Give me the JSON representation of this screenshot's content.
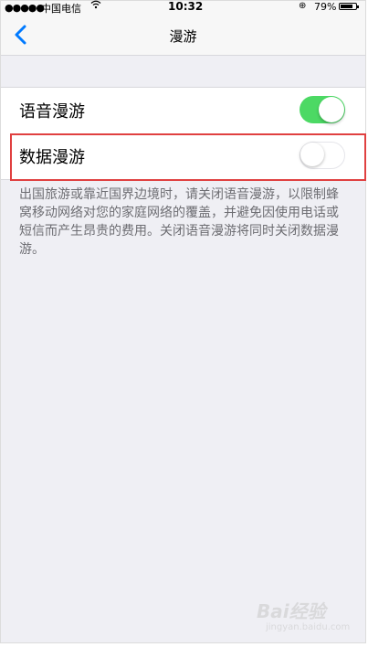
{
  "status_bar": {
    "signal": "●●●●●",
    "carrier": "中国电信",
    "time": "10:32",
    "battery_percent": "79%",
    "battery_level": 0.79
  },
  "navbar": {
    "title": "漫游",
    "back_icon": "chevron-left-icon"
  },
  "settings": {
    "items": [
      {
        "label": "语音漫游",
        "enabled": true
      },
      {
        "label": "数据漫游",
        "enabled": false
      }
    ]
  },
  "footer_text": "出国旅游或靠近国界边境时，请关闭语音漫游，以限制蜂窝移动网络对您的家庭网络的覆盖，并避免因使用电话或短信而产生昂贵的费用。关闭语音漫游将同时关闭数据漫游。",
  "colors": {
    "accent": "#007aff",
    "toggle_on": "#4cd964",
    "highlight": "#e04040"
  },
  "watermark": {
    "brand": "Bai经验",
    "sub": "jingyan.baidu.com"
  }
}
